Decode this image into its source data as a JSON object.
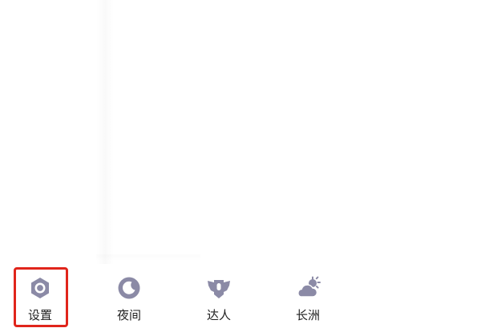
{
  "bottom_bar": {
    "items": [
      {
        "label": "设置",
        "icon": "settings-hexagon-icon"
      },
      {
        "label": "夜间",
        "icon": "moon-icon"
      },
      {
        "label": "达人",
        "icon": "winged-badge-icon"
      },
      {
        "label": "长洲",
        "icon": "weather-cloud-sun-icon"
      }
    ]
  },
  "colors": {
    "icon": "#8b8aa6",
    "label": "#222222",
    "highlight": "#e0251b"
  },
  "highlighted_item": "设置"
}
